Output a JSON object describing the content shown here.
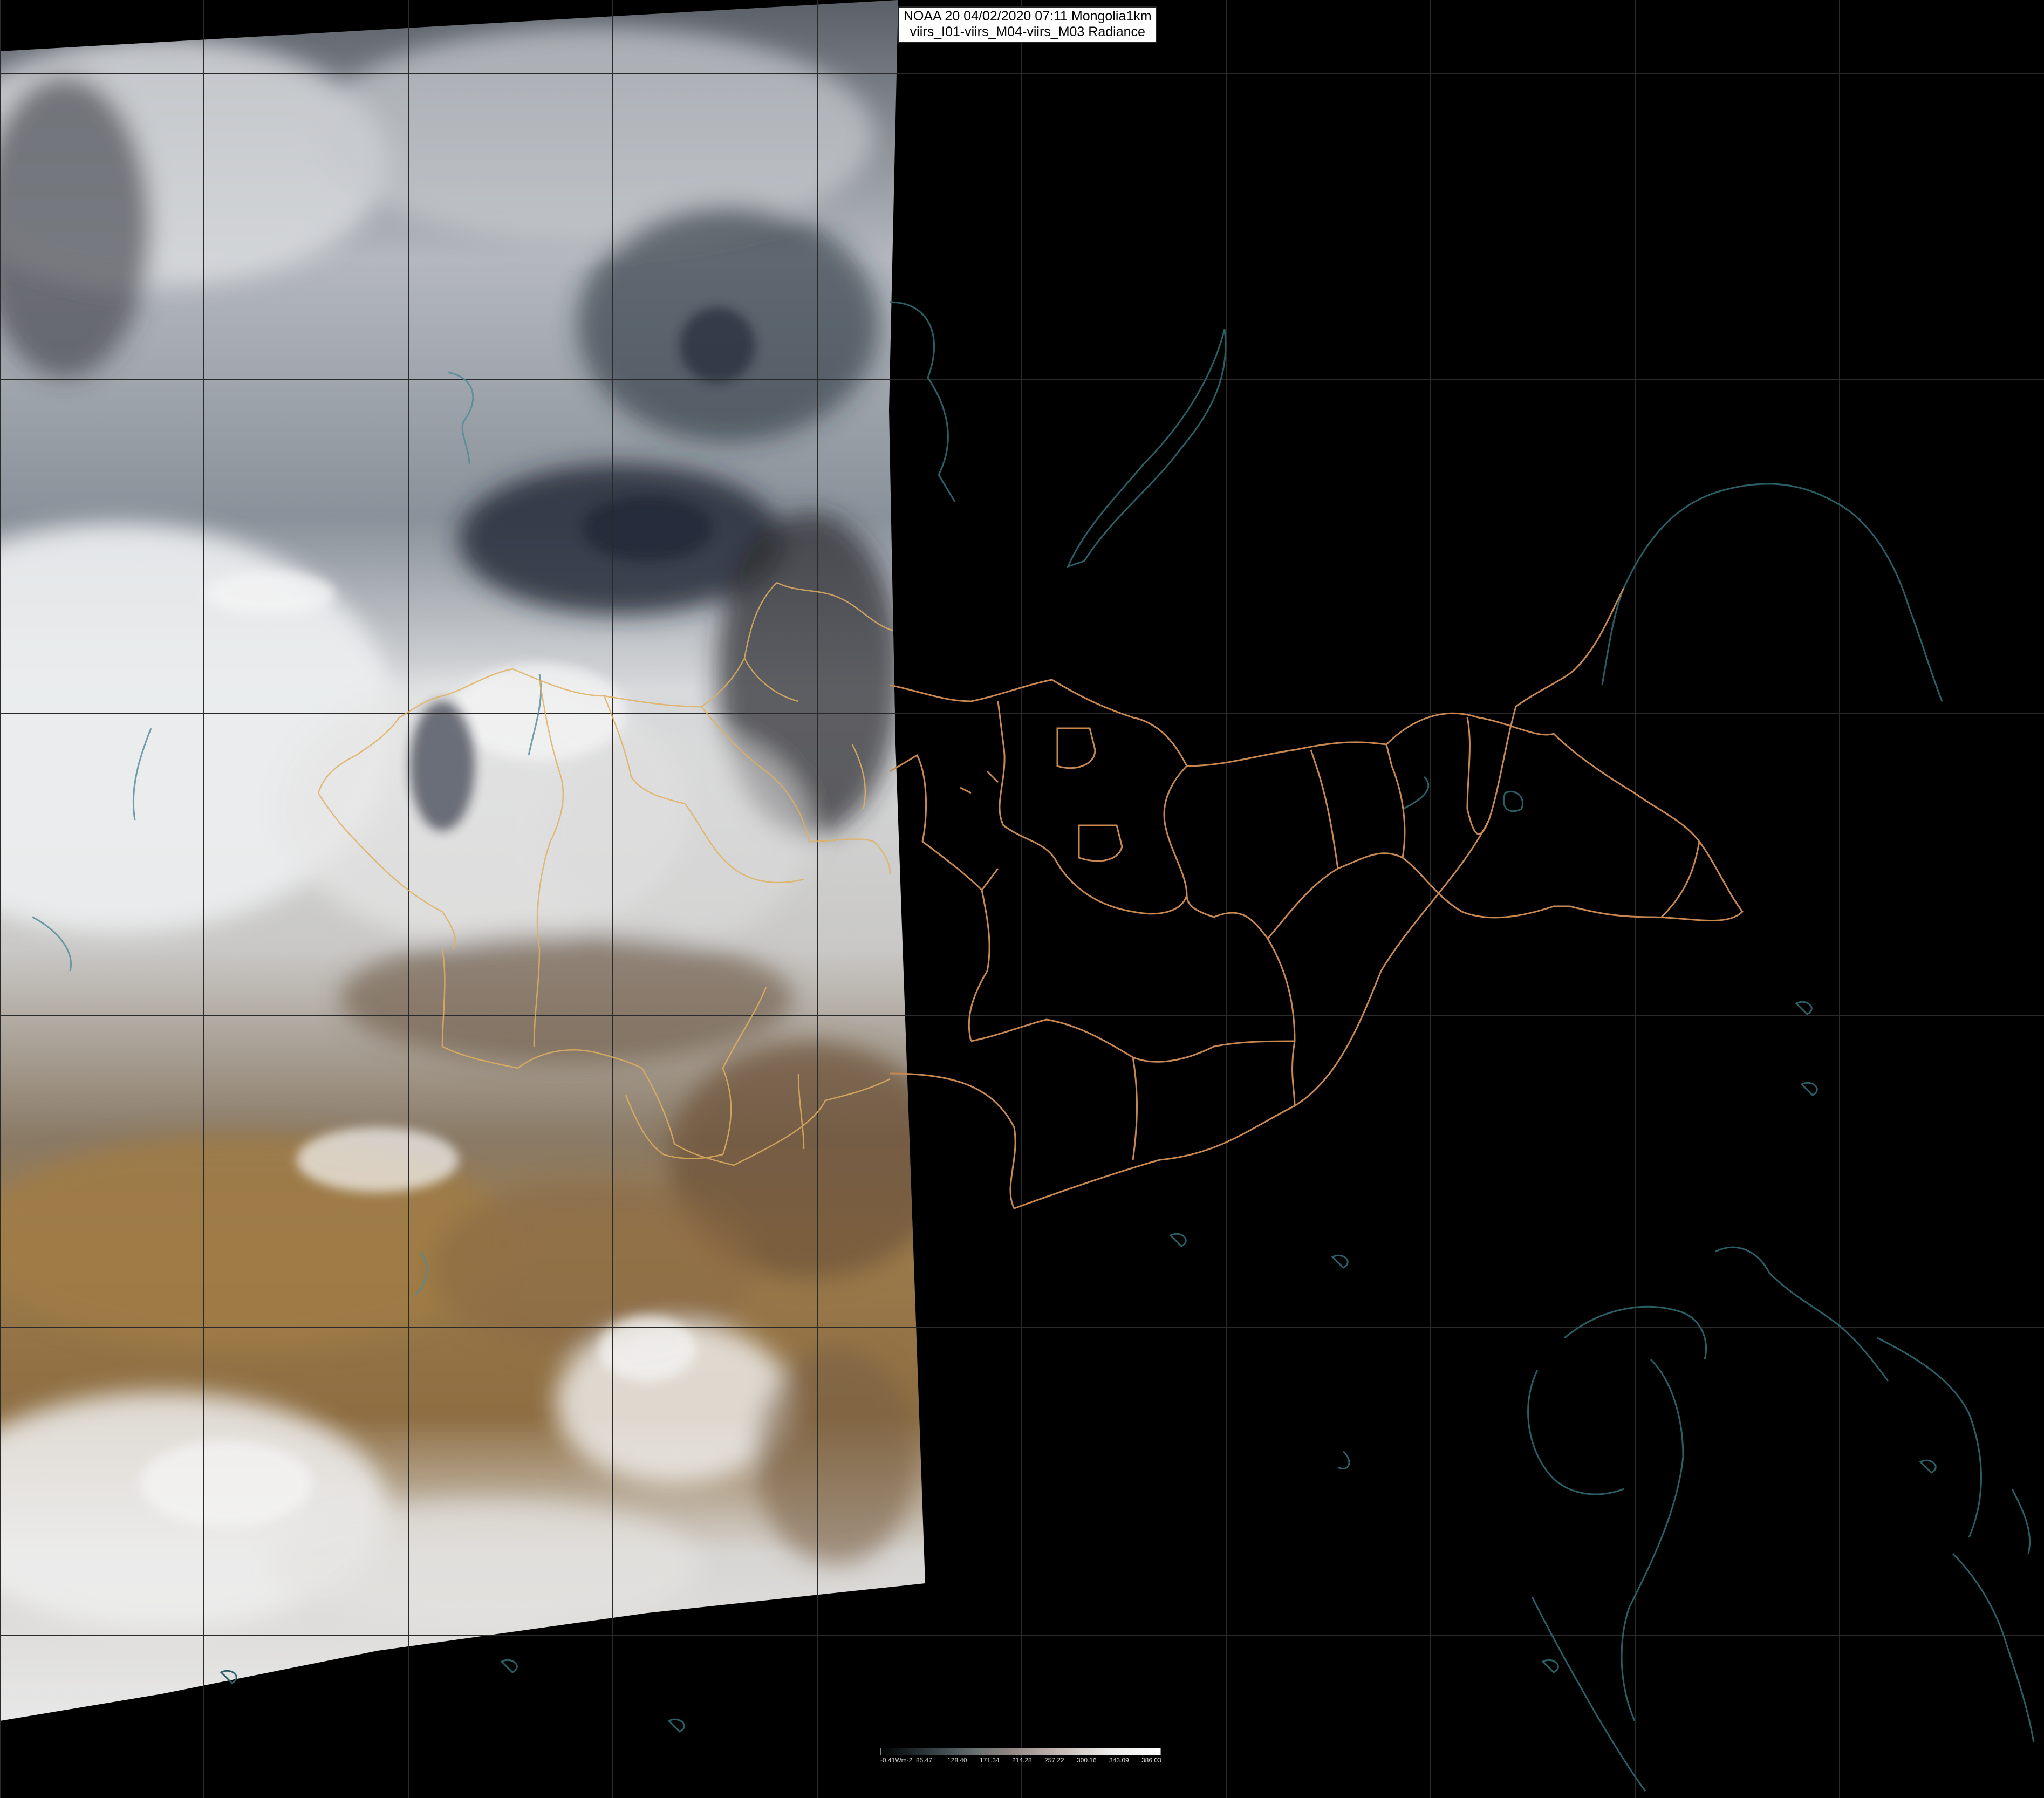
{
  "header": {
    "line1": "NOAA 20 04/02/2020 07:11 Mongolia1km",
    "line2": "viirs_I01-viirs_M04-viirs_M03 Radiance"
  },
  "colorbar": {
    "unit_label": "-0.41Wm-2",
    "ticks": [
      "85.47",
      "128.40",
      "171.34",
      "214.28",
      "257.22",
      "300.16",
      "343.09",
      "386.03"
    ]
  },
  "colors": {
    "background": "#000000",
    "graticule": "#2a2a2a",
    "province_border": "#c88850",
    "province_border_in_image": "#e0b060",
    "coastline": "#2a5f66",
    "cloud": "#e8eaec",
    "desert": "#9a7a48"
  }
}
